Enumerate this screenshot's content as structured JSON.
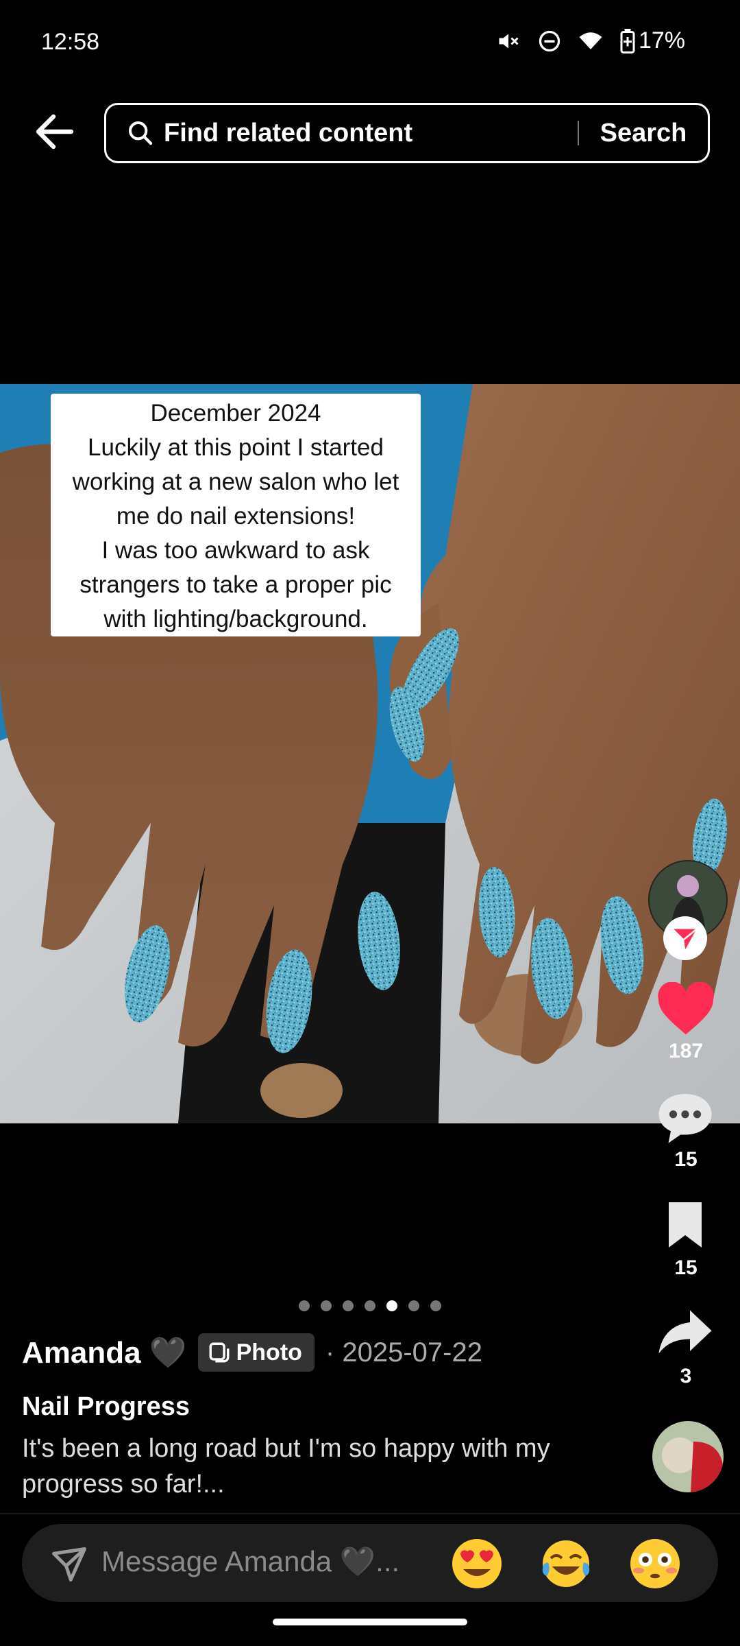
{
  "status_bar": {
    "time": "12:58",
    "battery": "17%",
    "icons": [
      "mute-icon",
      "do-not-disturb-icon",
      "wifi-icon",
      "battery-icon"
    ]
  },
  "search": {
    "placeholder": "Find related content",
    "button_label": "Search"
  },
  "photo_caption": {
    "lines": [
      "December 2024",
      "Luckily at this point I started",
      "working at a new salon who let",
      "me do nail extensions!",
      "I was too awkward to ask",
      "strangers to take a proper pic",
      "with lighting/background."
    ]
  },
  "actions": {
    "likes": "187",
    "comments": "15",
    "favorites": "15",
    "shares": "3",
    "like_color": "#fe2c55"
  },
  "carousel": {
    "total": 7,
    "active_index": 4
  },
  "post": {
    "author": "Amanda 🖤",
    "type_badge": "Photo",
    "date": "· 2025-07-22",
    "title": "Nail Progress",
    "description": "It's been a long road but I'm so happy with my progress so far!..."
  },
  "message_bar": {
    "placeholder": "Message Amanda 🖤...",
    "emojis": [
      "😍",
      "😂",
      "😳"
    ]
  }
}
